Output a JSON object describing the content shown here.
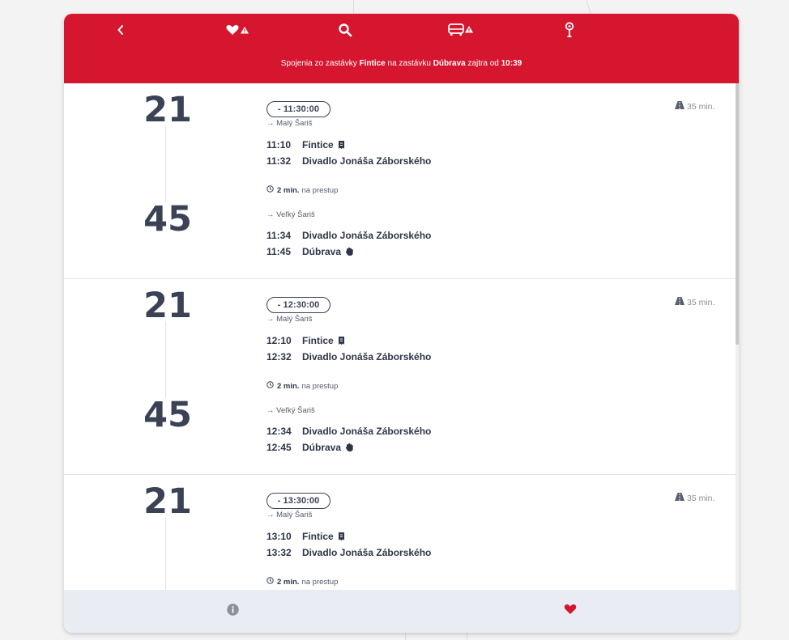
{
  "header": {
    "subtitle_prefix": "Spojenia zo zastávky",
    "from_stop": "Fintice",
    "mid_text": "na zastávku",
    "to_stop": "Dúbrava",
    "day_text": "zajtra od",
    "time": "10:39"
  },
  "header_icons": [
    "back-icon",
    "favorites-alert-icon",
    "search-icon",
    "bus-alert-icon",
    "stop-pin-icon"
  ],
  "footer_icons": [
    "info-icon",
    "heart-icon"
  ],
  "colors": {
    "brand_red": "#d6162f",
    "text_dark": "#3b4256",
    "muted": "#8a8f9b",
    "footer_bg": "#e9edf3"
  },
  "connections": [
    {
      "duration": "35 min.",
      "legs": [
        {
          "route": "21",
          "badge": "- 11:30:00",
          "direction": "→ Malý Šariš",
          "dep_time": "11:10",
          "dep_stop": "Fintice",
          "dep_icon": "ticket-request-icon",
          "arr_time": "11:32",
          "arr_stop": "Divadlo Jonáša Záborského"
        },
        {
          "route": "45",
          "direction": "→ Veľký Šariš",
          "dep_time": "11:34",
          "dep_stop": "Divadlo Jonáša Záborského",
          "arr_time": "11:45",
          "arr_stop": "Dúbrava",
          "arr_icon": "hand-stop-icon"
        }
      ],
      "transfer": {
        "minutes": "2 min.",
        "label": "na prestup"
      }
    },
    {
      "duration": "35 min.",
      "legs": [
        {
          "route": "21",
          "badge": "- 12:30:00",
          "direction": "→ Malý Šariš",
          "dep_time": "12:10",
          "dep_stop": "Fintice",
          "dep_icon": "ticket-request-icon",
          "arr_time": "12:32",
          "arr_stop": "Divadlo Jonáša Záborského"
        },
        {
          "route": "45",
          "direction": "→ Veľký Šariš",
          "dep_time": "12:34",
          "dep_stop": "Divadlo Jonáša Záborského",
          "arr_time": "12:45",
          "arr_stop": "Dúbrava",
          "arr_icon": "hand-stop-icon"
        }
      ],
      "transfer": {
        "minutes": "2 min.",
        "label": "na prestup"
      }
    },
    {
      "duration": "35 min.",
      "legs": [
        {
          "route": "21",
          "badge": "- 13:30:00",
          "direction": "→ Malý Šariš",
          "dep_time": "13:10",
          "dep_stop": "Fintice",
          "dep_icon": "ticket-request-icon",
          "arr_time": "13:32",
          "arr_stop": "Divadlo Jonáša Záborského"
        }
      ],
      "transfer": {
        "minutes": "2 min.",
        "label": "na prestup"
      }
    }
  ]
}
